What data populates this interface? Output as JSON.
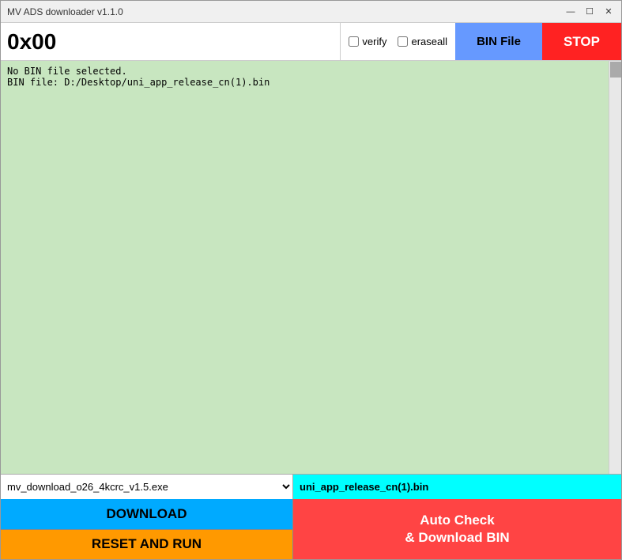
{
  "window": {
    "title": "MV ADS downloader v1.1.0",
    "controls": {
      "minimize": "—",
      "maximize": "☐",
      "close": "✕"
    }
  },
  "toolbar": {
    "hex_value": "0x00",
    "verify_label": "verify",
    "eraseall_label": "eraseall",
    "bin_file_button": "BIN File",
    "stop_button": "STOP"
  },
  "log": {
    "line1": "No BIN file selected.",
    "line2": "BIN file: D:/Desktop/uni_app_release_cn(1).bin"
  },
  "file_selector": {
    "exe_value": "mv_download_o26_4kcrc_v1.5.exe",
    "bin_value": "uni_app_release_cn(1).bin"
  },
  "actions": {
    "download_label": "DOWNLOAD",
    "reset_run_label": "RESET AND RUN",
    "auto_check_line1": "Auto Check",
    "auto_check_line2": "& Download BIN"
  }
}
